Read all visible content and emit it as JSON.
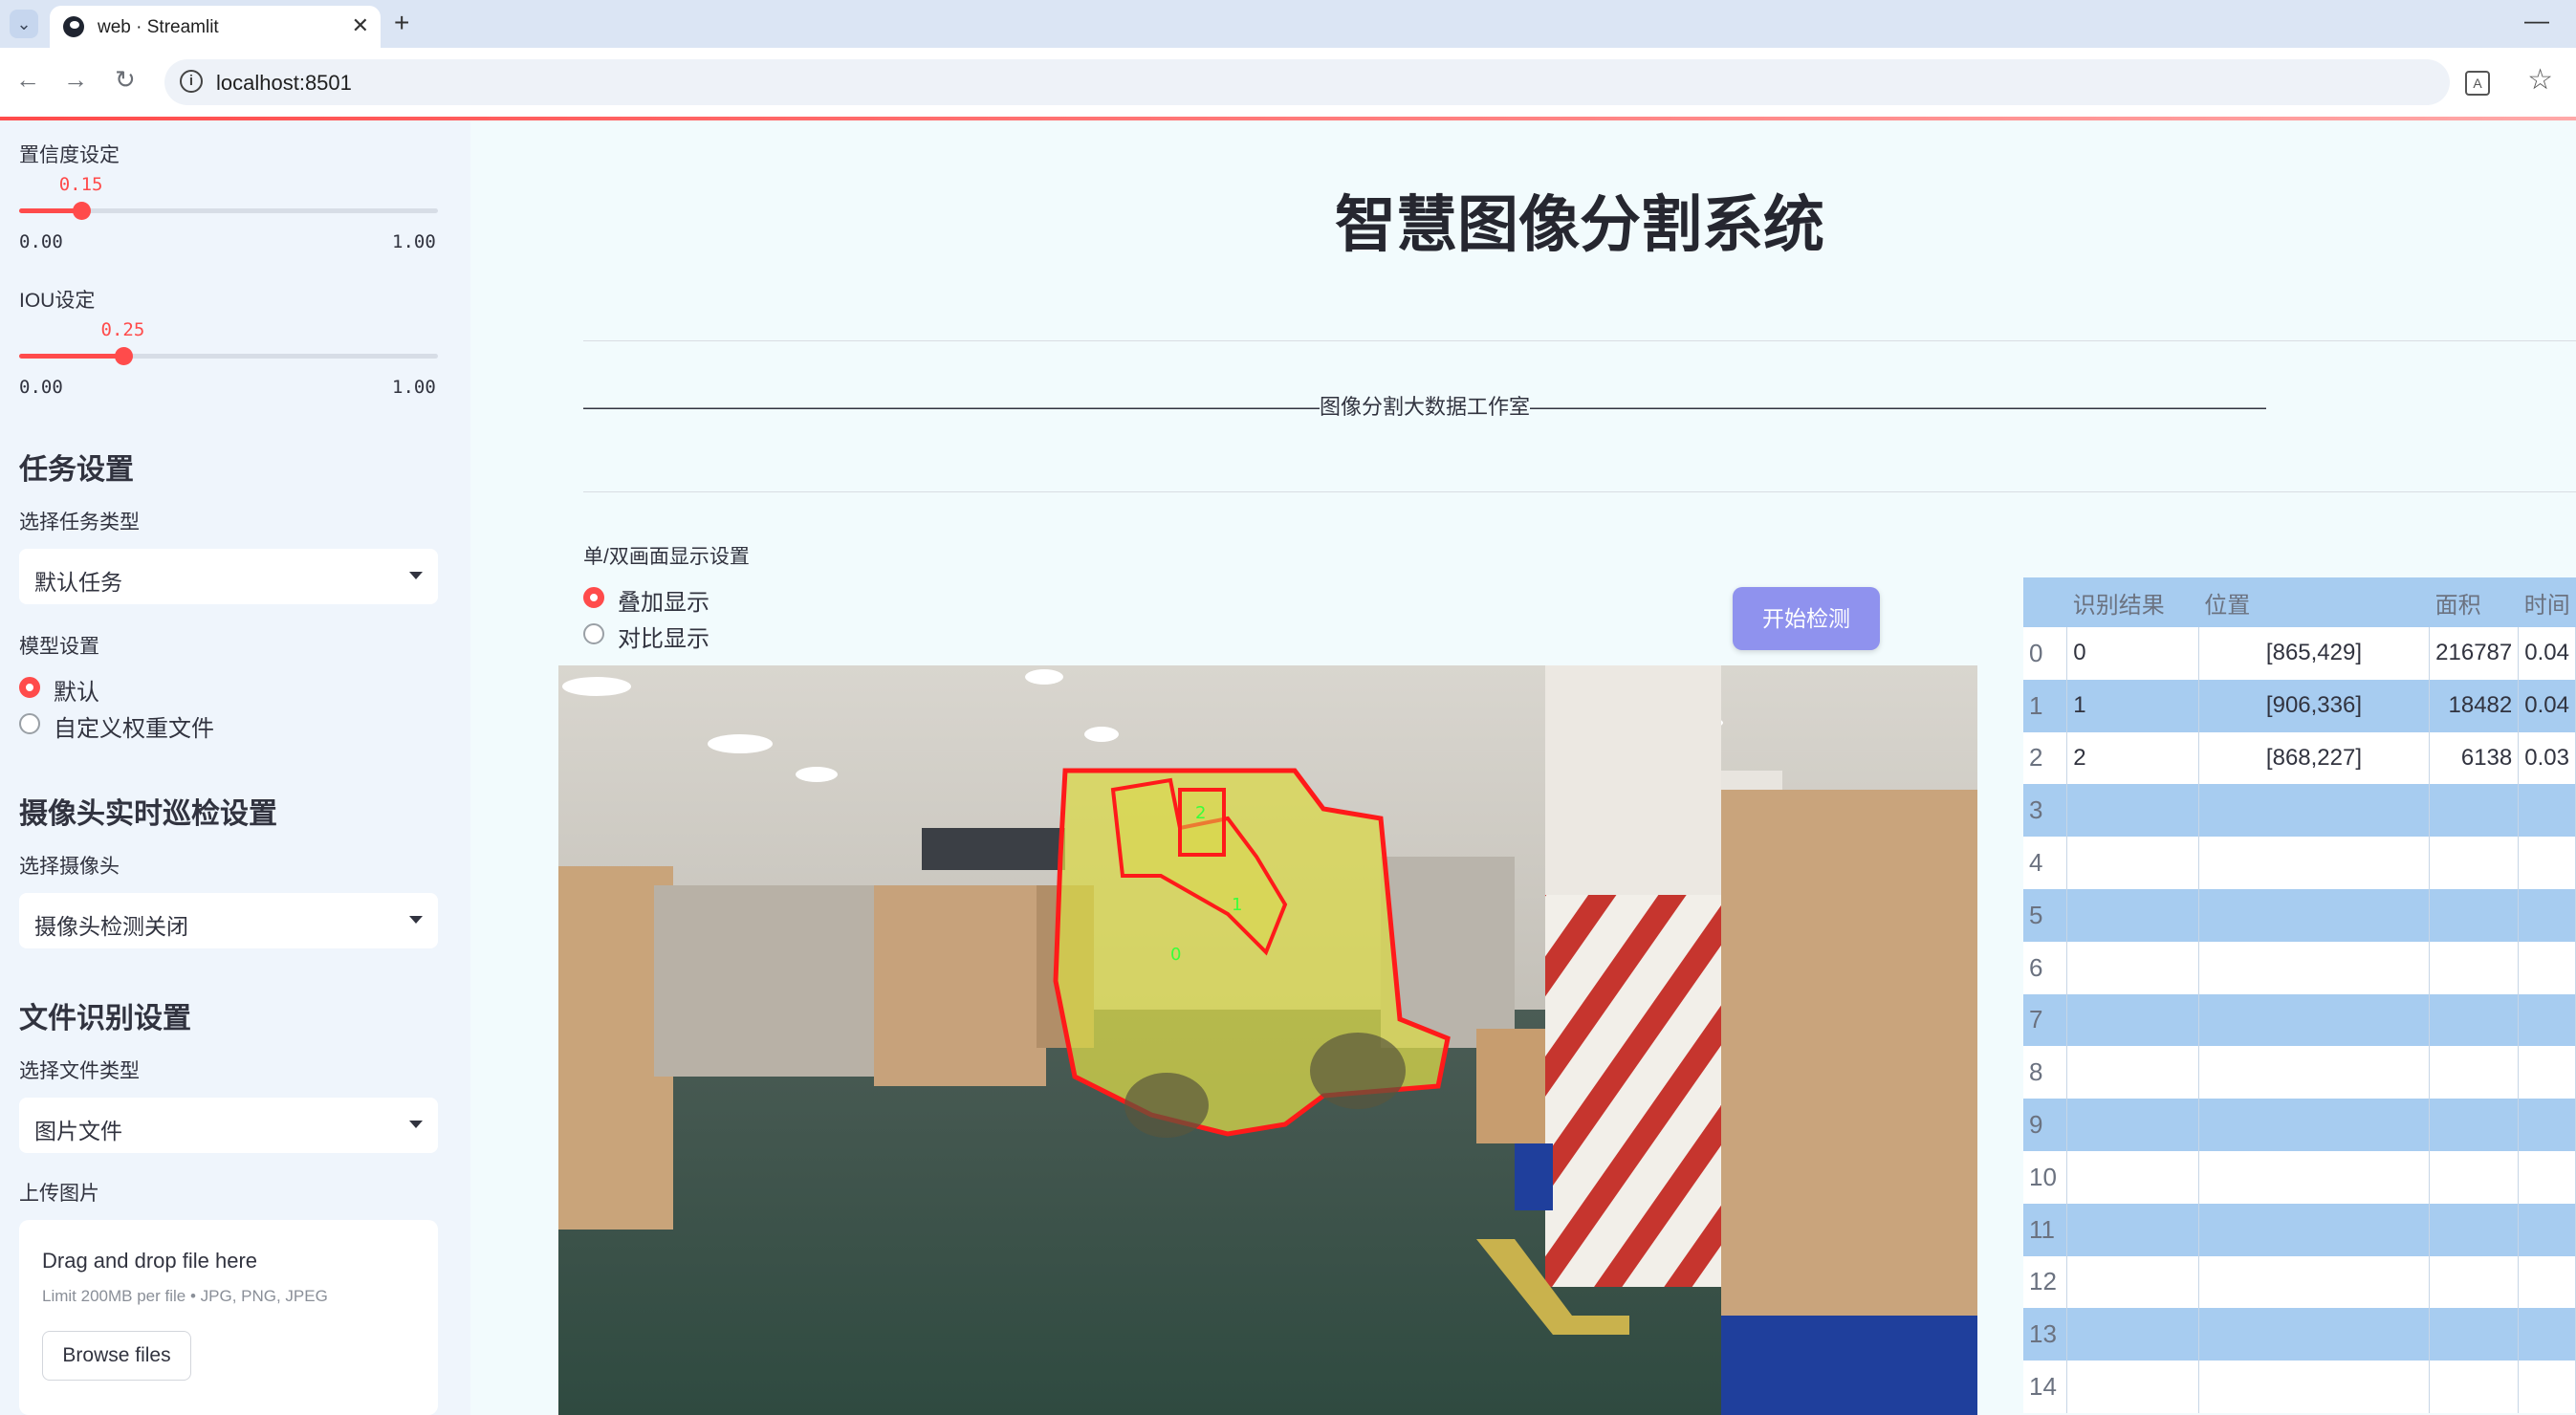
{
  "browser": {
    "tab_title": "web · Streamlit",
    "url": "localhost:8501"
  },
  "sidebar": {
    "confidence": {
      "label": "置信度设定",
      "value": "0.15",
      "value_num": 0.15,
      "min": "0.00",
      "max": "1.00"
    },
    "iou": {
      "label": "IOU设定",
      "value": "0.25",
      "value_num": 0.25,
      "min": "0.00",
      "max": "1.00"
    },
    "task_heading": "任务设置",
    "task_type_label": "选择任务类型",
    "task_type_value": "默认任务",
    "model_label": "模型设置",
    "model_options": [
      "默认",
      "自定义权重文件"
    ],
    "model_selected": "默认",
    "camera_heading": "摄像头实时巡检设置",
    "camera_label": "选择摄像头",
    "camera_value": "摄像头检测关闭",
    "file_heading": "文件识别设置",
    "file_type_label": "选择文件类型",
    "file_type_value": "图片文件",
    "upload_label": "上传图片",
    "upload": {
      "title": "Drag and drop file here",
      "limit": "Limit 200MB per file • JPG, PNG, JPEG",
      "button": "Browse files"
    }
  },
  "main": {
    "title": "智慧图像分割系统",
    "studio_line": "———————————————————————————————————图像分割大数据工作室———————————————————————————————————",
    "display_label": "单/双画面显示设置",
    "display_options": [
      "叠加显示",
      "对比显示"
    ],
    "display_selected": "叠加显示",
    "start_button": "开始检测",
    "image_labels": [
      "0",
      "1",
      "2"
    ]
  },
  "table": {
    "headers": [
      "",
      "识别结果",
      "位置",
      "面积",
      "时间"
    ],
    "rows": [
      {
        "idx": "0",
        "result": "0",
        "pos": "[865,429]",
        "area": "216787",
        "time": "0.04"
      },
      {
        "idx": "1",
        "result": "1",
        "pos": "[906,336]",
        "area": "18482",
        "time": "0.04"
      },
      {
        "idx": "2",
        "result": "2",
        "pos": "[868,227]",
        "area": "6138",
        "time": "0.03"
      },
      {
        "idx": "3",
        "result": "",
        "pos": "",
        "area": "",
        "time": ""
      },
      {
        "idx": "4",
        "result": "",
        "pos": "",
        "area": "",
        "time": ""
      },
      {
        "idx": "5",
        "result": "",
        "pos": "",
        "area": "",
        "time": ""
      },
      {
        "idx": "6",
        "result": "",
        "pos": "",
        "area": "",
        "time": ""
      },
      {
        "idx": "7",
        "result": "",
        "pos": "",
        "area": "",
        "time": ""
      },
      {
        "idx": "8",
        "result": "",
        "pos": "",
        "area": "",
        "time": ""
      },
      {
        "idx": "9",
        "result": "",
        "pos": "",
        "area": "",
        "time": ""
      },
      {
        "idx": "10",
        "result": "",
        "pos": "",
        "area": "",
        "time": ""
      },
      {
        "idx": "11",
        "result": "",
        "pos": "",
        "area": "",
        "time": ""
      },
      {
        "idx": "12",
        "result": "",
        "pos": "",
        "area": "",
        "time": ""
      },
      {
        "idx": "13",
        "result": "",
        "pos": "",
        "area": "",
        "time": ""
      },
      {
        "idx": "14",
        "result": "",
        "pos": "",
        "area": "",
        "time": ""
      }
    ]
  },
  "colors": {
    "accent": "#ff4b4b",
    "button": "#8f92ee",
    "table_stripe": "#a7ccf0",
    "mask": "#d9d84a",
    "outline": "#ff1a1a"
  }
}
